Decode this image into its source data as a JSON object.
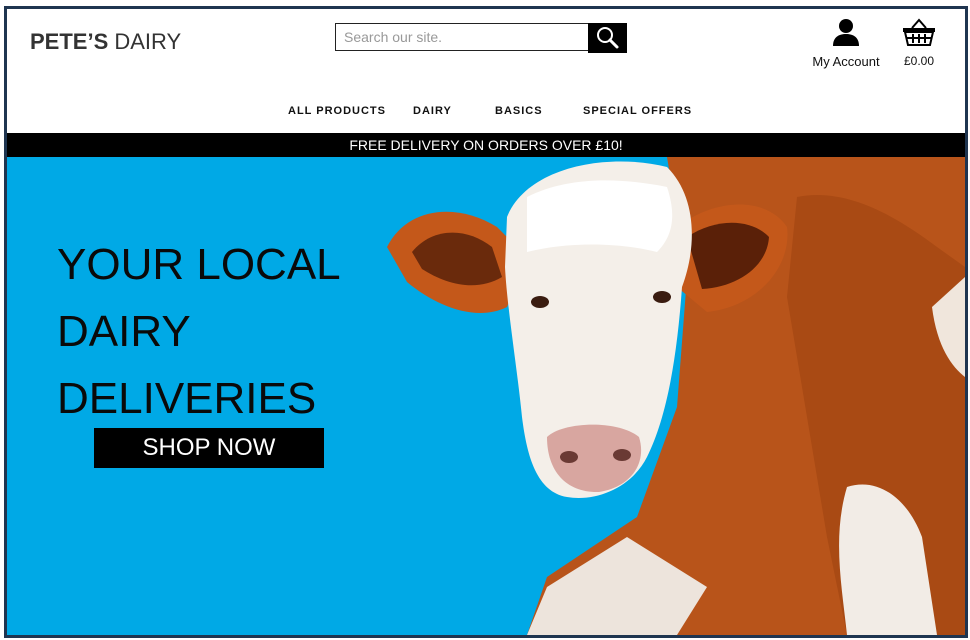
{
  "header": {
    "logo": {
      "bold": "PETE’S",
      "light": "DAIRY"
    },
    "search": {
      "placeholder": "Search our site.",
      "value": ""
    },
    "account_label": "My Account",
    "basket_total": "£0.00"
  },
  "nav": {
    "items": [
      {
        "label": "ALL PRODUCTS"
      },
      {
        "label": "DAIRY"
      },
      {
        "label": "BASICS"
      },
      {
        "label": "SPECIAL OFFERS"
      }
    ]
  },
  "banner": {
    "text": "FREE DELIVERY ON ORDERS OVER £10!"
  },
  "hero": {
    "headline": [
      "YOUR LOCAL",
      "DAIRY",
      "DELIVERIES"
    ],
    "cta_label": "SHOP NOW",
    "background_color": "#00a9e6",
    "image": "cow-photo"
  },
  "icons": {
    "search": "magnifier-icon",
    "account": "person-icon",
    "basket": "basket-icon"
  }
}
